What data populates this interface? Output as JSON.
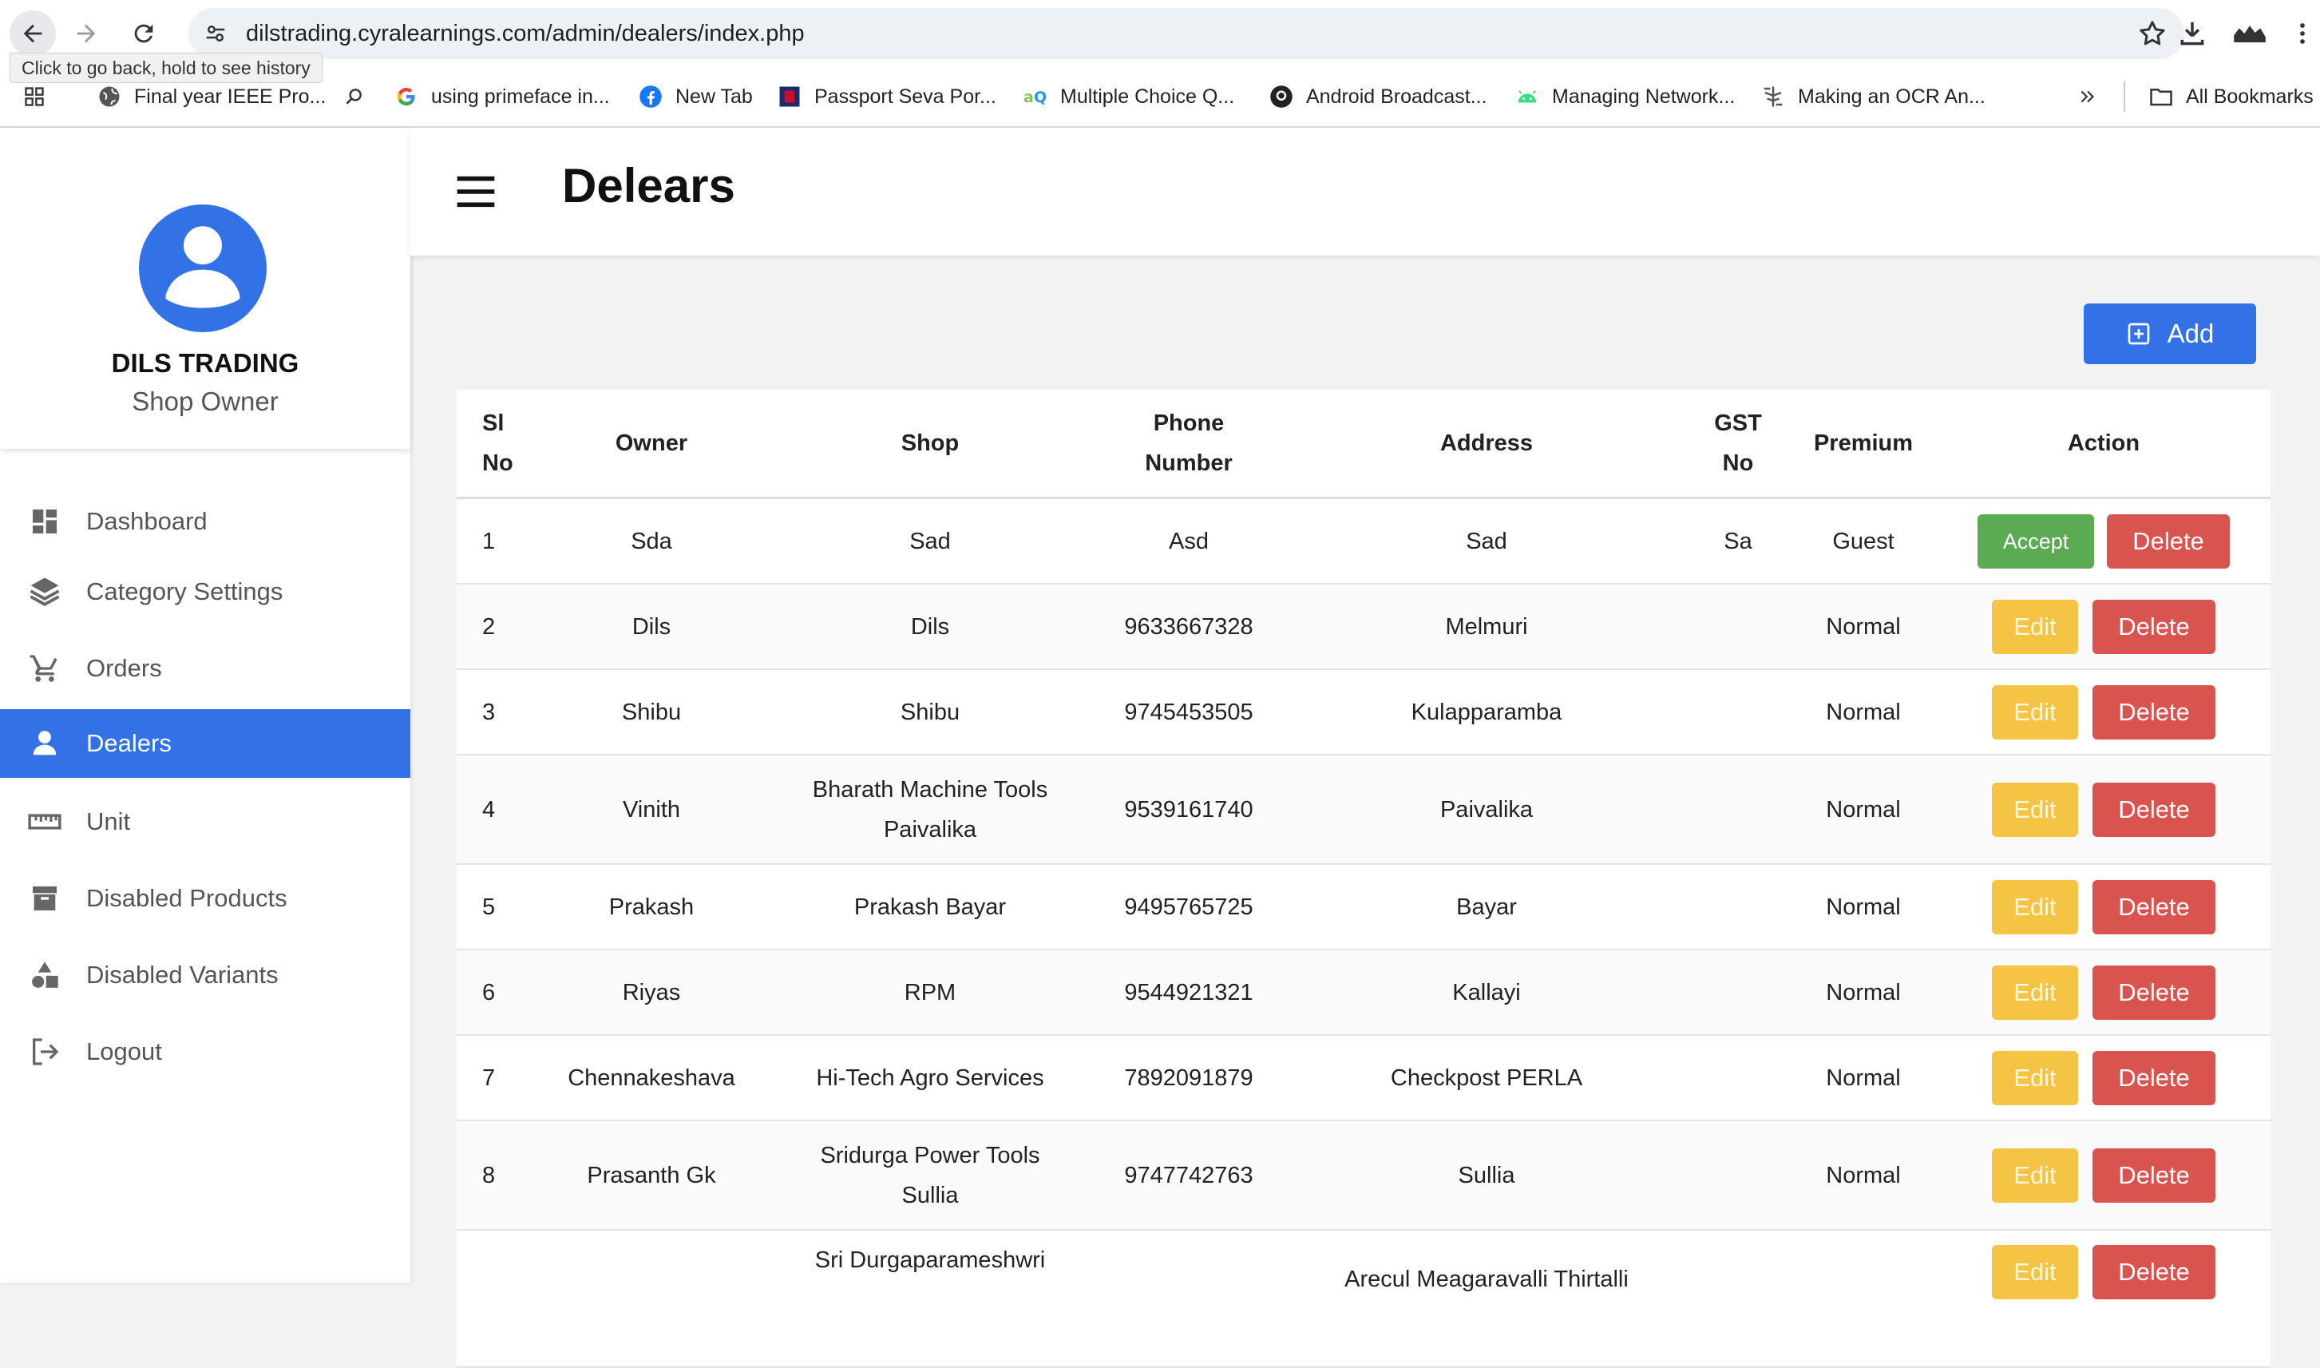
{
  "browser": {
    "url": "dilstrading.cyralearnings.com/admin/dealers/index.php",
    "tooltip": "Click to go back, hold to see history",
    "bookmarks": [
      {
        "label": "Final year IEEE Pro...",
        "icon": "globe-icon"
      },
      {
        "label": "using primeface in...",
        "icon": "google-icon"
      },
      {
        "label": "New Tab",
        "icon": "facebook-icon"
      },
      {
        "label": "Passport Seva Por...",
        "icon": "passport-icon"
      },
      {
        "label": "Multiple Choice Q...",
        "icon": "aq-icon"
      },
      {
        "label": "Android Broadcast...",
        "icon": "github-icon"
      },
      {
        "label": "Managing Network...",
        "icon": "android-icon"
      },
      {
        "label": "Making an OCR An...",
        "icon": "ocr-icon"
      }
    ],
    "all_bookmarks": "All Bookmarks"
  },
  "sidebar": {
    "brand_name": "DILS TRADING",
    "brand_role": "Shop Owner",
    "items": [
      {
        "label": "Dashboard",
        "icon": "dashboard-icon",
        "active": false
      },
      {
        "label": "Category Settings",
        "icon": "layers-icon",
        "active": false
      },
      {
        "label": "Orders",
        "icon": "cart-icon",
        "active": false
      },
      {
        "label": "Dealers",
        "icon": "person-icon",
        "active": true
      },
      {
        "label": "Unit",
        "icon": "ruler-icon",
        "active": false
      },
      {
        "label": "Disabled Products",
        "icon": "archive-icon",
        "active": false
      },
      {
        "label": "Disabled Variants",
        "icon": "shapes-icon",
        "active": false
      },
      {
        "label": "Logout",
        "icon": "logout-icon",
        "active": false
      }
    ]
  },
  "header": {
    "title": "Delears"
  },
  "add_label": "Add",
  "table": {
    "columns": {
      "sl1": "Sl",
      "sl2": "No",
      "owner": "Owner",
      "shop": "Shop",
      "phone1": "Phone",
      "phone2": "Number",
      "address": "Address",
      "gst1": "GST",
      "gst2": "No",
      "premium": "Premium",
      "action": "Action"
    },
    "labels": {
      "accept": "Accept",
      "edit": "Edit",
      "delete": "Delete"
    },
    "rows": [
      {
        "sl": "1",
        "owner": "Sda",
        "shop1": "Sad",
        "shop2": "",
        "phone": "Asd",
        "address1": "Sad",
        "address2": "",
        "gst": "Sa",
        "premium": "Guest"
      },
      {
        "sl": "2",
        "owner": "Dils",
        "shop1": "Dils",
        "shop2": "",
        "phone": "9633667328",
        "address1": "Melmuri",
        "address2": "",
        "gst": "",
        "premium": "Normal"
      },
      {
        "sl": "3",
        "owner": "Shibu",
        "shop1": "Shibu",
        "shop2": "",
        "phone": "9745453505",
        "address1": "Kulapparamba",
        "address2": "",
        "gst": "",
        "premium": "Normal"
      },
      {
        "sl": "4",
        "owner": "Vinith",
        "shop1": "Bharath Machine Tools",
        "shop2": "Paivalika",
        "phone": "9539161740",
        "address1": "Paivalika",
        "address2": "",
        "gst": "",
        "premium": "Normal"
      },
      {
        "sl": "5",
        "owner": "Prakash",
        "shop1": "Prakash Bayar",
        "shop2": "",
        "phone": "9495765725",
        "address1": "Bayar",
        "address2": "",
        "gst": "",
        "premium": "Normal"
      },
      {
        "sl": "6",
        "owner": "Riyas",
        "shop1": "RPM",
        "shop2": "",
        "phone": "9544921321",
        "address1": "Kallayi",
        "address2": "",
        "gst": "",
        "premium": "Normal"
      },
      {
        "sl": "7",
        "owner": "Chennakeshava",
        "shop1": "Hi-Tech Agro Services",
        "shop2": "",
        "phone": "7892091879",
        "address1": "Checkpost PERLA",
        "address2": "",
        "gst": "",
        "premium": "Normal"
      },
      {
        "sl": "8",
        "owner": "Prasanth Gk",
        "shop1": "Sridurga Power Tools",
        "shop2": "Sullia",
        "phone": "9747742763",
        "address1": "Sullia",
        "address2": "",
        "gst": "",
        "premium": "Normal"
      },
      {
        "sl": "",
        "owner": "",
        "shop1": "Sri Durgaparameshwri",
        "shop2": "",
        "phone": "",
        "address1": "Arecul Meagaravalli Thirtalli",
        "address2": "",
        "gst": "",
        "premium": ""
      }
    ]
  }
}
